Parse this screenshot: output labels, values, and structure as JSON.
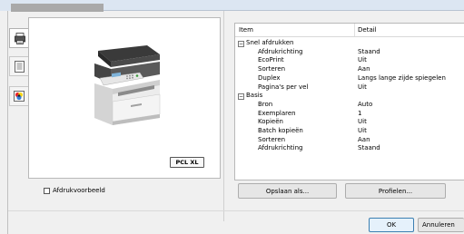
{
  "sidebar": {
    "items": [
      {
        "icon": "printer-settings-icon",
        "active": true
      },
      {
        "icon": "document-list-icon",
        "active": false
      },
      {
        "icon": "color-icon",
        "active": false
      }
    ]
  },
  "preview": {
    "badge": "PCL XL"
  },
  "table": {
    "headers": {
      "item": "Item",
      "detail": "Detail"
    },
    "rows": [
      {
        "type": "group",
        "item": "Snel afdrukken",
        "detail": ""
      },
      {
        "type": "row",
        "item": "Afdrukrichting",
        "detail": "Staand"
      },
      {
        "type": "row",
        "item": "EcoPrint",
        "detail": "Uit"
      },
      {
        "type": "row",
        "item": "Sorteren",
        "detail": "Aan"
      },
      {
        "type": "row",
        "item": "Duplex",
        "detail": "Langs lange zijde spiegelen"
      },
      {
        "type": "row",
        "item": "Pagina's per vel",
        "detail": "Uit"
      },
      {
        "type": "group",
        "item": "Basis",
        "detail": ""
      },
      {
        "type": "row",
        "item": "Bron",
        "detail": "Auto"
      },
      {
        "type": "row",
        "item": "Exemplaren",
        "detail": "1"
      },
      {
        "type": "row",
        "item": "Kopieën",
        "detail": "Uit"
      },
      {
        "type": "row",
        "item": "Batch kopieën",
        "detail": "Uit"
      },
      {
        "type": "row",
        "item": "Sorteren",
        "detail": "Aan"
      },
      {
        "type": "row",
        "item": "Afdrukrichting",
        "detail": "Staand"
      }
    ]
  },
  "checkbox": {
    "label": "Afdrukvoorbeeld",
    "checked": false
  },
  "buttons": {
    "save": "Opslaan als...",
    "profiles": "Profielen...",
    "ok": "OK",
    "cancel": "Annuleren"
  }
}
